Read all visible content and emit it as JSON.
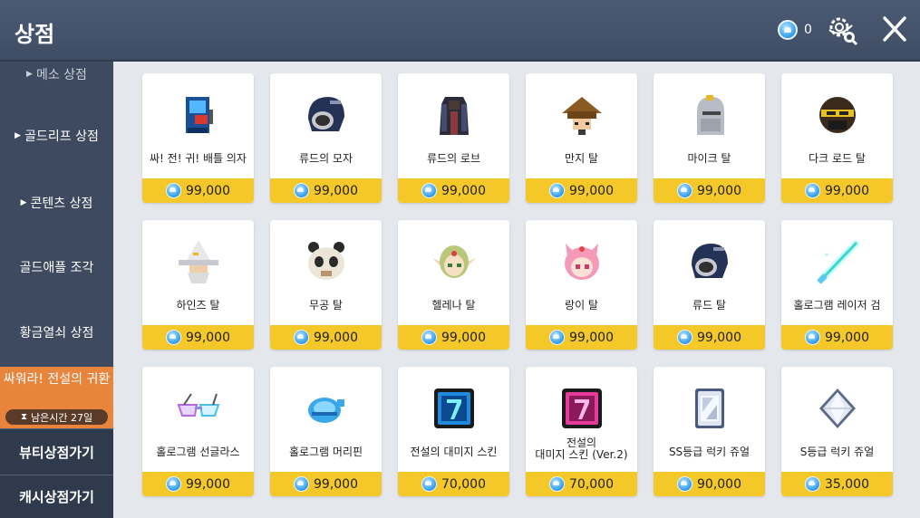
{
  "header": {
    "title": "상점",
    "currency_amount": "0"
  },
  "sidebar": {
    "items": [
      {
        "label": "메소 상점"
      },
      {
        "label": "골드리프 상점"
      },
      {
        "label": "콘텐츠 상점"
      },
      {
        "label": "골드애플 조각"
      },
      {
        "label": "황금열쇠 상점"
      }
    ],
    "event": {
      "title": "싸워라! 전설의 귀환",
      "time_left": "남은시간 27일"
    },
    "beauty_button": "뷰티상점가기",
    "cash_button": "캐시상점가기"
  },
  "items": [
    {
      "name": "싸! 전! 귀! 배틀 의자",
      "price": "99,000",
      "icon": "arcade-chair-icon"
    },
    {
      "name": "류드의 모자",
      "price": "99,000",
      "icon": "hood-hat-icon"
    },
    {
      "name": "류드의 로브",
      "price": "99,000",
      "icon": "robe-icon"
    },
    {
      "name": "만지 탈",
      "price": "99,000",
      "icon": "straw-hat-mask-icon"
    },
    {
      "name": "마이크 탈",
      "price": "99,000",
      "icon": "knight-helmet-icon"
    },
    {
      "name": "다크 로드 탈",
      "price": "99,000",
      "icon": "dark-lord-mask-icon"
    },
    {
      "name": "하인즈 탈",
      "price": "99,000",
      "icon": "wizard-hat-mask-icon"
    },
    {
      "name": "무공 탈",
      "price": "99,000",
      "icon": "panda-mask-icon"
    },
    {
      "name": "헬레나 탈",
      "price": "99,000",
      "icon": "elf-mask-icon"
    },
    {
      "name": "랑이 탈",
      "price": "99,000",
      "icon": "pink-cat-mask-icon"
    },
    {
      "name": "류드 탈",
      "price": "99,000",
      "icon": "hood-mask-icon"
    },
    {
      "name": "홀로그램 레이저 검",
      "price": "99,000",
      "icon": "laser-sword-icon"
    },
    {
      "name": "홀로그램 선글라스",
      "price": "99,000",
      "icon": "hologram-sunglasses-icon"
    },
    {
      "name": "홀로그램 머리핀",
      "price": "99,000",
      "icon": "hologram-hairpin-icon"
    },
    {
      "name": "전설의 대미지 스킨",
      "price": "70,000",
      "icon": "blue-damage-skin-icon"
    },
    {
      "name": "전설의\n대미지 스킨 (Ver.2)",
      "price": "70,000",
      "icon": "pink-damage-skin-icon"
    },
    {
      "name": "SS등급 럭키 쥬얼",
      "price": "90,000",
      "icon": "ss-jewel-icon"
    },
    {
      "name": "S등급 럭키 쥬얼",
      "price": "35,000",
      "icon": "s-jewel-icon"
    }
  ]
}
